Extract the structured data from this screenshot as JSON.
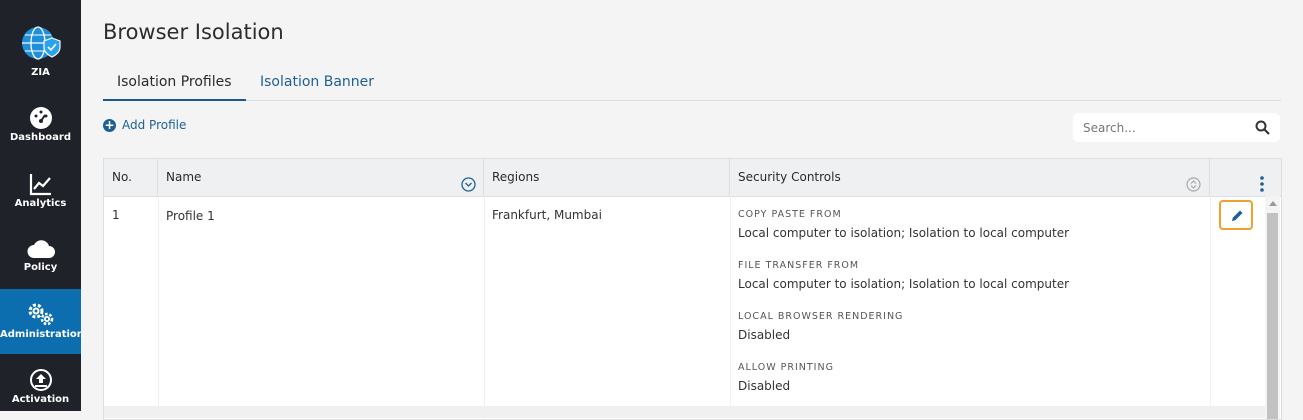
{
  "sidebar": {
    "items": [
      {
        "label": "ZIA",
        "icon": "globe-shield-icon"
      },
      {
        "label": "Dashboard",
        "icon": "dashboard-gauge-icon"
      },
      {
        "label": "Analytics",
        "icon": "analytics-chart-icon"
      },
      {
        "label": "Policy",
        "icon": "cloud-icon"
      },
      {
        "label": "Administration",
        "icon": "gears-icon",
        "active": true
      },
      {
        "label": "Activation",
        "icon": "activation-upload-icon"
      }
    ]
  },
  "page": {
    "title": "Browser Isolation"
  },
  "tabs": [
    {
      "label": "Isolation Profiles",
      "active": true
    },
    {
      "label": "Isolation Banner",
      "active": false
    }
  ],
  "toolbar": {
    "add_label": "Add Profile"
  },
  "search": {
    "placeholder": "Search..."
  },
  "table": {
    "headers": {
      "no": "No.",
      "name": "Name",
      "regions": "Regions",
      "security": "Security Controls"
    },
    "rows": [
      {
        "no": "1",
        "name": "Profile 1",
        "regions": "Frankfurt, Mumbai",
        "security_controls": [
          {
            "label": "COPY PASTE FROM",
            "value": "Local computer to isolation; Isolation to local computer"
          },
          {
            "label": "FILE TRANSFER FROM",
            "value": "Local computer to isolation; Isolation to local computer"
          },
          {
            "label": "LOCAL BROWSER RENDERING",
            "value": "Disabled"
          },
          {
            "label": "ALLOW PRINTING",
            "value": "Disabled"
          }
        ]
      }
    ]
  },
  "colors": {
    "sidebar_bg": "#1f2228",
    "active_nav": "#0d6eaf",
    "accent": "#1e5f96",
    "edit_highlight": "#f0a030"
  }
}
